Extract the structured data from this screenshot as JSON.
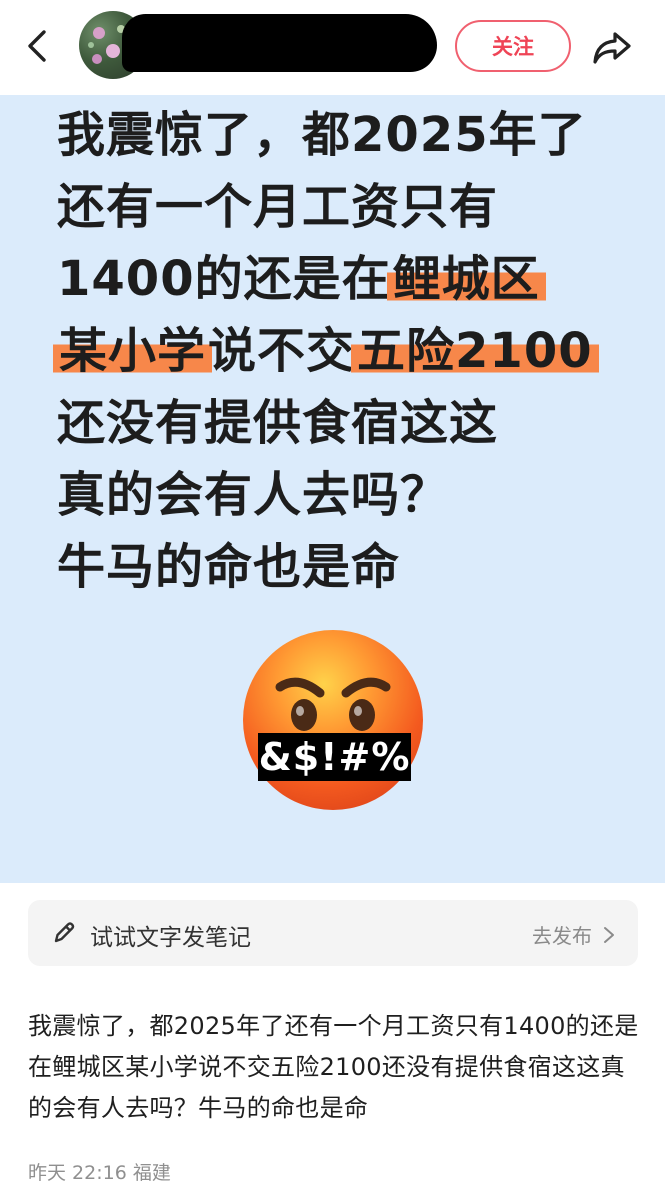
{
  "header": {
    "follow_label": "关注"
  },
  "post_image": {
    "headline_lines": [
      "我震惊了，都2025年了",
      "还有一个月工资只有",
      "1400的还是在",
      "鲤城区",
      "某小学",
      "说不交",
      "五险2100",
      "还没有提供食宿这这",
      "真的会有人去吗？",
      "牛马的命也是命"
    ],
    "emoji_censor_text": "&$!#%",
    "highlight_color": "#f7874a",
    "background_color": "#dbebfb"
  },
  "compose_prompt": {
    "label": "试试文字发笔记",
    "action_label": "去发布"
  },
  "post": {
    "body_text": "我震惊了，都2025年了还有一个月工资只有1400的还是在鲤城区某小学说不交五险2100还没有提供食宿这这真的会有人去吗？牛马的命也是命",
    "meta": "昨天 22:16 福建"
  },
  "colors": {
    "accent": "#ef4456"
  },
  "icons": [
    "back-arrow-icon",
    "share-icon",
    "pen-icon",
    "chevron-right-icon",
    "angry-face-emoji"
  ]
}
